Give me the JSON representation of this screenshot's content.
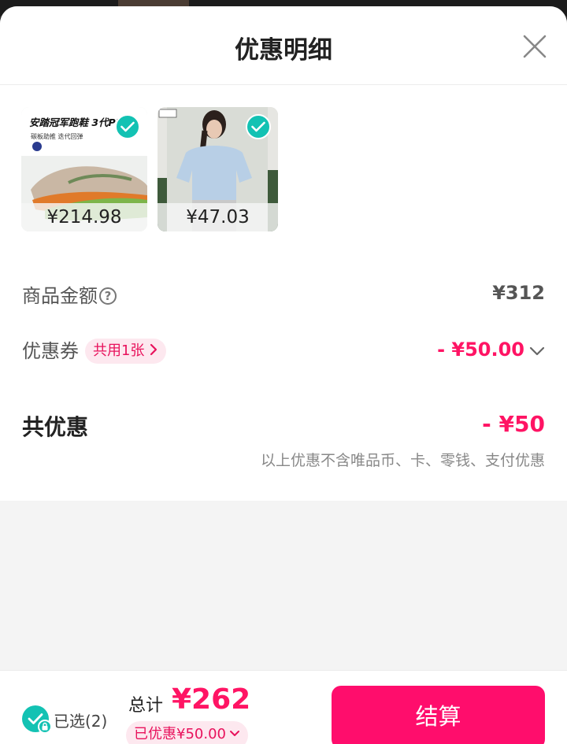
{
  "header": {
    "title": "优惠明细"
  },
  "products": [
    {
      "price": "¥214.98",
      "banner_text": "安踏冠军跑鞋 3代PR",
      "sub_text": "碳板助推 迭代回弹",
      "checked": true
    },
    {
      "price": "¥47.03",
      "checked": true
    }
  ],
  "summary": {
    "goods_amount_label": "商品金额",
    "goods_amount_value": "¥312",
    "coupon_label": "优惠券",
    "coupon_tag": "共用1张",
    "coupon_value": "- ¥50.00",
    "total_discount_label": "共优惠",
    "total_discount_value": "- ¥50",
    "note": "以上优惠不含唯品币、卡、零钱、支付优惠"
  },
  "bottom_bar": {
    "selected_label": "已选(2)",
    "total_caption": "总计",
    "total_amount": "¥262",
    "saved_text": "已优惠¥50.00",
    "checkout_label": "结算"
  },
  "colors": {
    "accent_pink": "#ff1464",
    "checkout_button": "#ff0d6c",
    "check_teal": "#13c2b3"
  },
  "icons": [
    "close-icon",
    "check-icon",
    "help-icon",
    "chevron-right-icon",
    "chevron-down-icon",
    "lock-icon"
  ]
}
